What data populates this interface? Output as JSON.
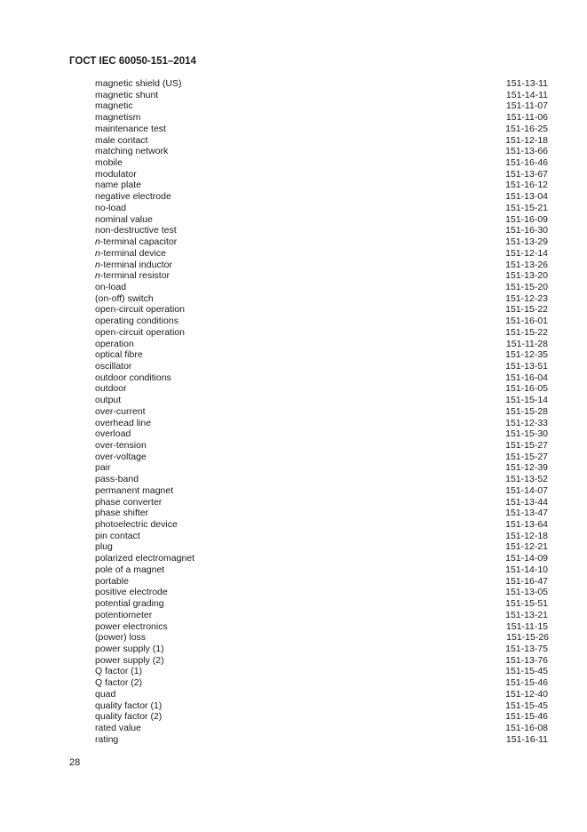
{
  "document": {
    "header": "ГОСТ IEC 60050-151–2014",
    "page_number": "28"
  },
  "index_entries": [
    {
      "prefix": "",
      "term": "magnetic shield (US)",
      "code": "151-13-11"
    },
    {
      "prefix": "",
      "term": "magnetic shunt",
      "code": "151-14-11"
    },
    {
      "prefix": "",
      "term": "magnetic",
      "code": "151-11-07"
    },
    {
      "prefix": "",
      "term": "magnetism",
      "code": "151-11-06"
    },
    {
      "prefix": "",
      "term": "maintenance test",
      "code": "151-16-25"
    },
    {
      "prefix": "",
      "term": "male contact",
      "code": "151-12-18"
    },
    {
      "prefix": "",
      "term": "matching network",
      "code": "151-13-66"
    },
    {
      "prefix": "",
      "term": "mobile",
      "code": "151-16-46"
    },
    {
      "prefix": "",
      "term": "modulator",
      "code": "151-13-67"
    },
    {
      "prefix": "",
      "term": "name plate",
      "code": "151-16-12"
    },
    {
      "prefix": "",
      "term": "negative electrode",
      "code": "151-13-04"
    },
    {
      "prefix": "",
      "term": "no-load",
      "code": "151-15-21"
    },
    {
      "prefix": "",
      "term": "nominal value",
      "code": "151-16-09"
    },
    {
      "prefix": "",
      "term": "non-destructive test",
      "code": "151-16-30"
    },
    {
      "prefix": "n",
      "term": "-terminal capacitor",
      "code": "151-13-29"
    },
    {
      "prefix": "n",
      "term": "-terminal device",
      "code": "151-12-14"
    },
    {
      "prefix": "n",
      "term": "-terminal inductor",
      "code": "151-13-26"
    },
    {
      "prefix": "n",
      "term": "-terminal resistor",
      "code": "151-13-20"
    },
    {
      "prefix": "",
      "term": "on-load",
      "code": "151-15-20"
    },
    {
      "prefix": "",
      "term": "(on-off) switch",
      "code": "151-12-23"
    },
    {
      "prefix": "",
      "term": "open-circuit operation",
      "code": "151-15-22"
    },
    {
      "prefix": "",
      "term": "operating conditions",
      "code": "151-16-01"
    },
    {
      "prefix": "",
      "term": "open-circuit operation",
      "code": "151-15-22"
    },
    {
      "prefix": "",
      "term": "operation",
      "code": "151-11-28"
    },
    {
      "prefix": "",
      "term": "optical fibre",
      "code": "151-12-35"
    },
    {
      "prefix": "",
      "term": "oscillator",
      "code": "151-13-51"
    },
    {
      "prefix": "",
      "term": "outdoor conditions",
      "code": "151-16-04"
    },
    {
      "prefix": "",
      "term": "outdoor",
      "code": "151-16-05"
    },
    {
      "prefix": "",
      "term": "output",
      "code": "151-15-14"
    },
    {
      "prefix": "",
      "term": "over-current",
      "code": "151-15-28"
    },
    {
      "prefix": "",
      "term": "overhead line",
      "code": "151-12-33"
    },
    {
      "prefix": "",
      "term": "overload",
      "code": "151-15-30"
    },
    {
      "prefix": "",
      "term": "over-tension",
      "code": "151-15-27"
    },
    {
      "prefix": "",
      "term": "over-voltage",
      "code": "151-15-27"
    },
    {
      "prefix": "",
      "term": "pair",
      "code": "151-12-39"
    },
    {
      "prefix": "",
      "term": "pass-band",
      "code": "151-13-52"
    },
    {
      "prefix": "",
      "term": "permanent magnet",
      "code": "151-14-07"
    },
    {
      "prefix": "",
      "term": "phase converter",
      "code": "151-13-44"
    },
    {
      "prefix": "",
      "term": "phase shifter",
      "code": "151-13-47"
    },
    {
      "prefix": "",
      "term": "photoelectric device",
      "code": "151-13-64"
    },
    {
      "prefix": "",
      "term": "pin contact",
      "code": "151-12-18"
    },
    {
      "prefix": "",
      "term": "plug",
      "code": "151-12-21"
    },
    {
      "prefix": "",
      "term": "polarized electromagnet",
      "code": "151-14-09"
    },
    {
      "prefix": "",
      "term": "pole of a magnet",
      "code": "151-14-10"
    },
    {
      "prefix": "",
      "term": "portable",
      "code": "151-16-47"
    },
    {
      "prefix": "",
      "term": "positive electrode",
      "code": "151-13-05"
    },
    {
      "prefix": "",
      "term": "potential grading",
      "code": "151-15-51"
    },
    {
      "prefix": "",
      "term": "potentiometer",
      "code": "151-13-21"
    },
    {
      "prefix": "",
      "term": "power electronics",
      "code": "151-11-15"
    },
    {
      "prefix": "",
      "term": "(power) loss",
      "code": "151-15-26"
    },
    {
      "prefix": "",
      "term": "power supply (1)",
      "code": "151-13-75"
    },
    {
      "prefix": "",
      "term": "power supply (2)",
      "code": "151-13-76"
    },
    {
      "prefix": "",
      "term": "Q factor (1)",
      "code": "151-15-45"
    },
    {
      "prefix": "",
      "term": "Q factor (2)",
      "code": "151-15-46"
    },
    {
      "prefix": "",
      "term": "quad",
      "code": "151-12-40"
    },
    {
      "prefix": "",
      "term": "quality factor (1)",
      "code": "151-15-45"
    },
    {
      "prefix": "",
      "term": "quality factor (2)",
      "code": "151-15-46"
    },
    {
      "prefix": "",
      "term": "rated value",
      "code": "151-16-08"
    },
    {
      "prefix": "",
      "term": "rating",
      "code": "151-16-11"
    }
  ]
}
